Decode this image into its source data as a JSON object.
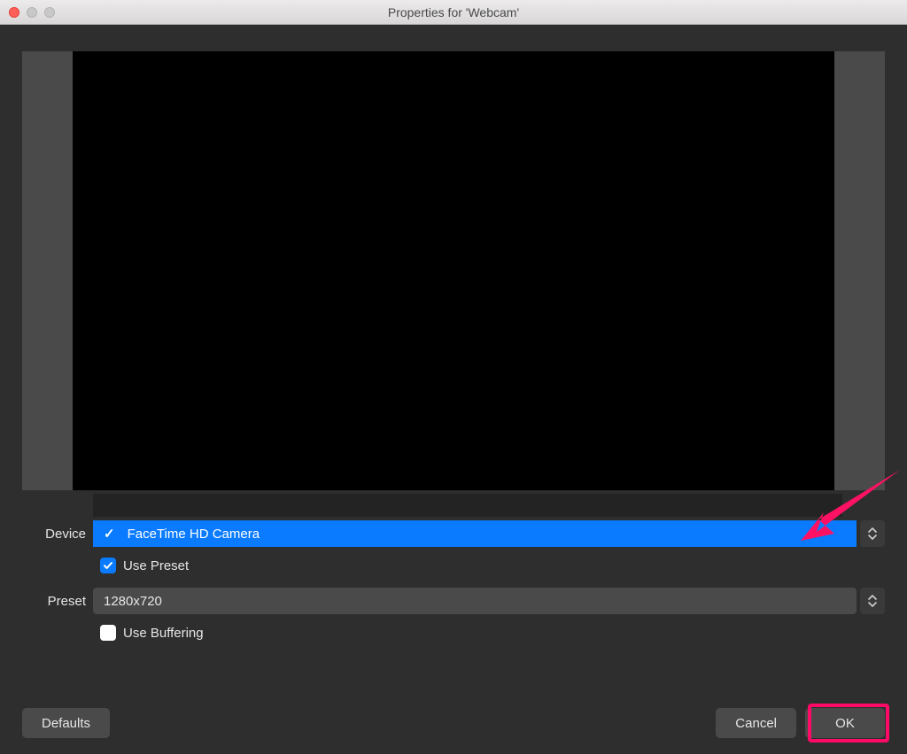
{
  "window": {
    "title": "Properties for 'Webcam'"
  },
  "form": {
    "device_label": "Device",
    "device_value": "FaceTime HD Camera",
    "use_preset_label": "Use Preset",
    "use_preset_checked": true,
    "preset_label": "Preset",
    "preset_value": "1280x720",
    "use_buffering_label": "Use Buffering",
    "use_buffering_checked": false
  },
  "buttons": {
    "defaults": "Defaults",
    "cancel": "Cancel",
    "ok": "OK"
  }
}
